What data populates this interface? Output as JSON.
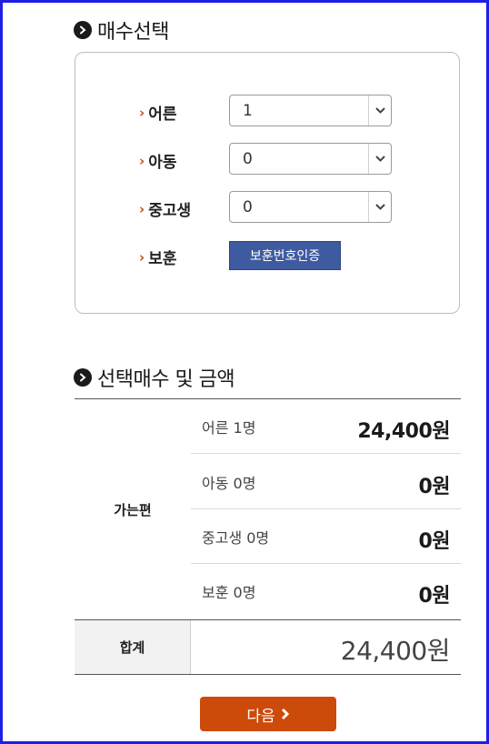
{
  "ticket_select": {
    "title": "매수선택",
    "rows": [
      {
        "label": "어른",
        "value": "1"
      },
      {
        "label": "아동",
        "value": "0"
      },
      {
        "label": "중고생",
        "value": "0"
      }
    ],
    "veteran": {
      "label": "보훈",
      "button": "보훈번호인증"
    }
  },
  "summary": {
    "title": "선택매수 및 금액",
    "category": "가는편",
    "lines": [
      {
        "label": "어른 1명",
        "amount": "24,400원"
      },
      {
        "label": "아동 0명",
        "amount": "0원"
      },
      {
        "label": "중고생 0명",
        "amount": "0원"
      },
      {
        "label": "보훈 0명",
        "amount": "0원"
      }
    ],
    "total_label": "합계",
    "total_amount": "24,400원"
  },
  "next_button": "다음",
  "colors": {
    "accent": "#cc4a0a",
    "button_blue": "#3f5ba0",
    "frame": "#1e1ee6"
  }
}
